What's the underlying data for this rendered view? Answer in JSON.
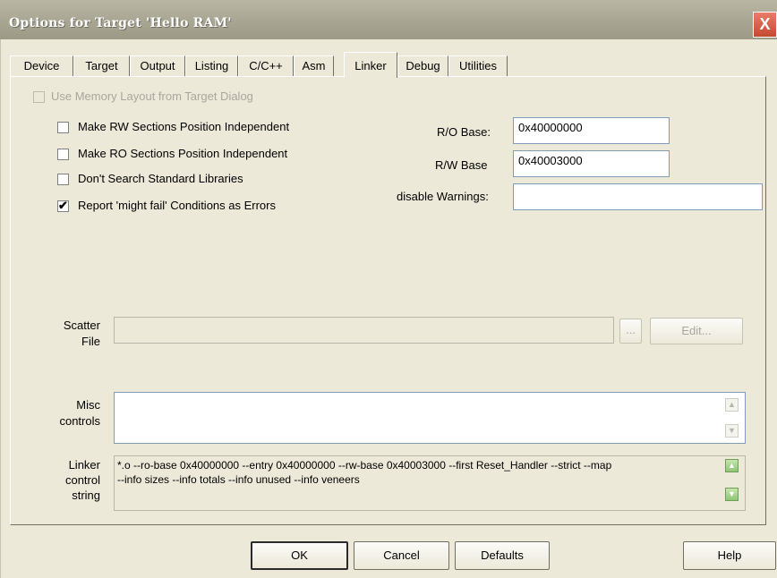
{
  "window": {
    "title": "Options for Target 'Hello RAM'",
    "close_glyph": "X"
  },
  "tabs": [
    "Device",
    "Target",
    "Output",
    "Listing",
    "C/C++",
    "Asm",
    "Linker",
    "Debug",
    "Utilities"
  ],
  "active_tab": "Linker",
  "memory_layout": {
    "label": "Use Memory Layout from Target Dialog",
    "checked": false,
    "enabled": false
  },
  "options": [
    {
      "label": "Make RW Sections Position Independent",
      "checked": false
    },
    {
      "label": "Make RO Sections Position Independent",
      "checked": false
    },
    {
      "label": "Don't Search Standard Libraries",
      "checked": false
    },
    {
      "label": "Report 'might fail' Conditions as Errors",
      "checked": true
    }
  ],
  "check_mark": "✔",
  "ro_base": {
    "label": "R/O Base:",
    "value": "0x40000000"
  },
  "rw_base": {
    "label": "R/W Base",
    "value": "0x40003000"
  },
  "disable_warnings": {
    "label": "disable Warnings:",
    "value": ""
  },
  "scatter": {
    "label_line1": "Scatter",
    "label_line2": "File",
    "value": "",
    "browse_label": "...",
    "edit_label": "Edit..."
  },
  "misc": {
    "label_line1": "Misc",
    "label_line2": "controls",
    "value": ""
  },
  "linker_control": {
    "label_line1": "Linker",
    "label_line2": "control",
    "label_line3": "string",
    "line1": "*.o --ro-base 0x40000000 --entry 0x40000000 --rw-base 0x40003000 --first Reset_Handler --strict --map",
    "line2": "--info sizes --info totals --info unused --info veneers"
  },
  "buttons": {
    "ok": "OK",
    "cancel": "Cancel",
    "defaults": "Defaults",
    "help": "Help"
  },
  "icons": {
    "close": "close-icon",
    "scroll_up": "chevron-up-icon",
    "scroll_down": "chevron-down-icon"
  },
  "colors": {
    "dialog_bg": "#ece9d8",
    "titlebar": "#a8a592",
    "close_button": "#c44a2e",
    "field_border": "#7f9db9",
    "scroll_active": "#8fc577"
  }
}
